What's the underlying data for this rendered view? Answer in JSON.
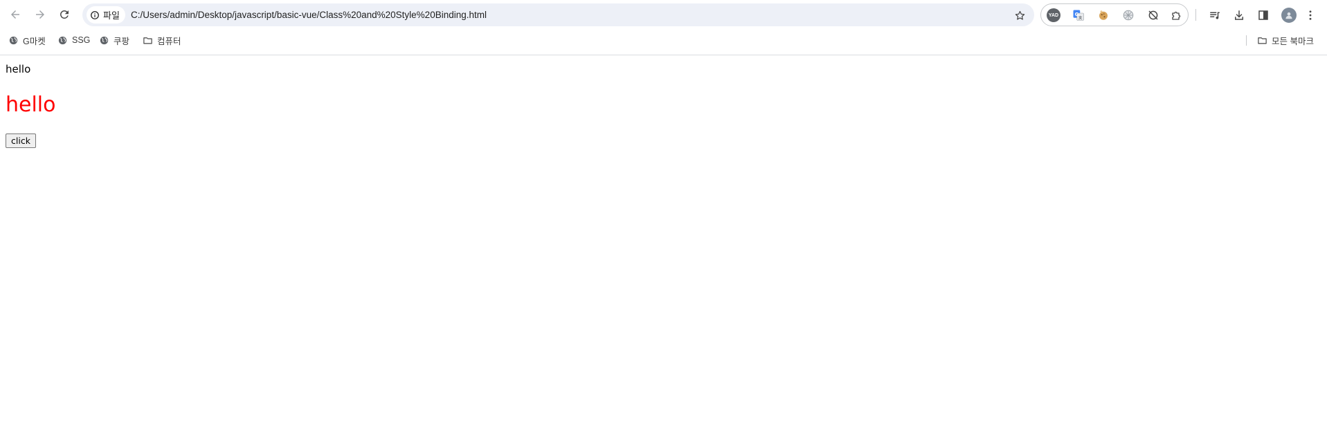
{
  "browser": {
    "address_chip_label": "파일",
    "url": "C:/Users/admin/Desktop/javascript/basic-vue/Class%20and%20Style%20Binding.html",
    "extensions": [
      "yad-icon",
      "translate-icon",
      "cookie-icon",
      "grid-extension-icon",
      "sync-off-icon",
      "puzzle-icon"
    ],
    "ext1_label": "YAD"
  },
  "bookmarks": {
    "items": [
      {
        "label": "G마켓",
        "icon": "globe-icon"
      },
      {
        "label": "SSG",
        "icon": "globe-icon"
      },
      {
        "label": "쿠팡",
        "icon": "globe-icon"
      },
      {
        "label": "컴퓨터",
        "icon": "folder-icon"
      }
    ],
    "all_bookmarks": "모든 북마크"
  },
  "page": {
    "text_plain": "hello",
    "text_styled": "hello",
    "styled_color": "#ff0000",
    "button_label": "click"
  }
}
